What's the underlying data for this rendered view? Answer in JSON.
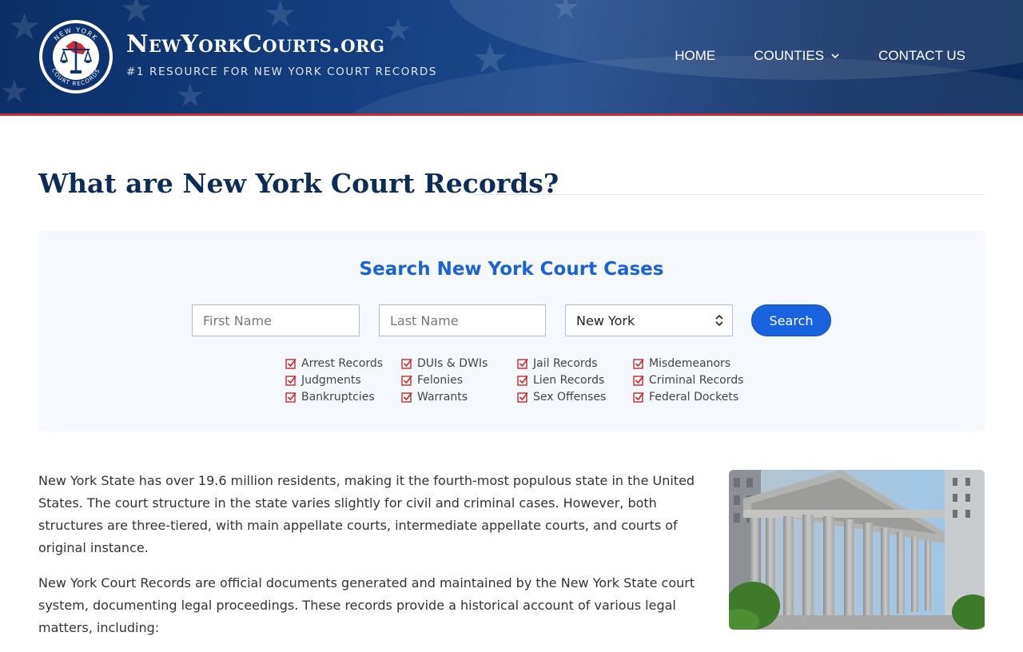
{
  "header": {
    "brand_title": "NewYorkCourts.org",
    "tagline": "#1 RESOURCE FOR NEW YORK COURT RECORDS",
    "seal_text_top": "NEW YORK",
    "seal_text_bottom": "COURT RECORDS",
    "nav": [
      {
        "label": "HOME"
      },
      {
        "label": "COUNTIES",
        "has_dropdown": true
      },
      {
        "label": "CONTACT US"
      }
    ],
    "colors": {
      "primary": "#0b2f66",
      "accent_red": "#d02a33"
    }
  },
  "page": {
    "title": "What are New York Court Records?"
  },
  "search": {
    "title": "Search New York Court Cases",
    "first_name_placeholder": "First Name",
    "last_name_placeholder": "Last Name",
    "state_selected": "New York",
    "button_label": "Search",
    "record_types": [
      "Arrest Records",
      "DUIs & DWIs",
      "Jail Records",
      "Misdemeanors",
      "Judgments",
      "Felonies",
      "Lien Records",
      "Criminal Records",
      "Bankruptcies",
      "Warrants",
      "Sex Offenses",
      "Federal Dockets"
    ],
    "colors": {
      "title": "#1a63d1",
      "button": "#1a63e0",
      "check": "#c62a2a"
    }
  },
  "content": {
    "paragraph_1": "New York State has over 19.6 million residents, making it the fourth-most populous state in the United States. The court structure in the state varies slightly for civil and criminal cases. However, both structures are three-tiered, with main appellate courts, intermediate appellate courts, and courts of original instance.",
    "paragraph_2": "New York Court Records are official documents generated and maintained by the New York State court system, documenting legal proceedings. These records provide a historical account of various legal matters, including:"
  }
}
